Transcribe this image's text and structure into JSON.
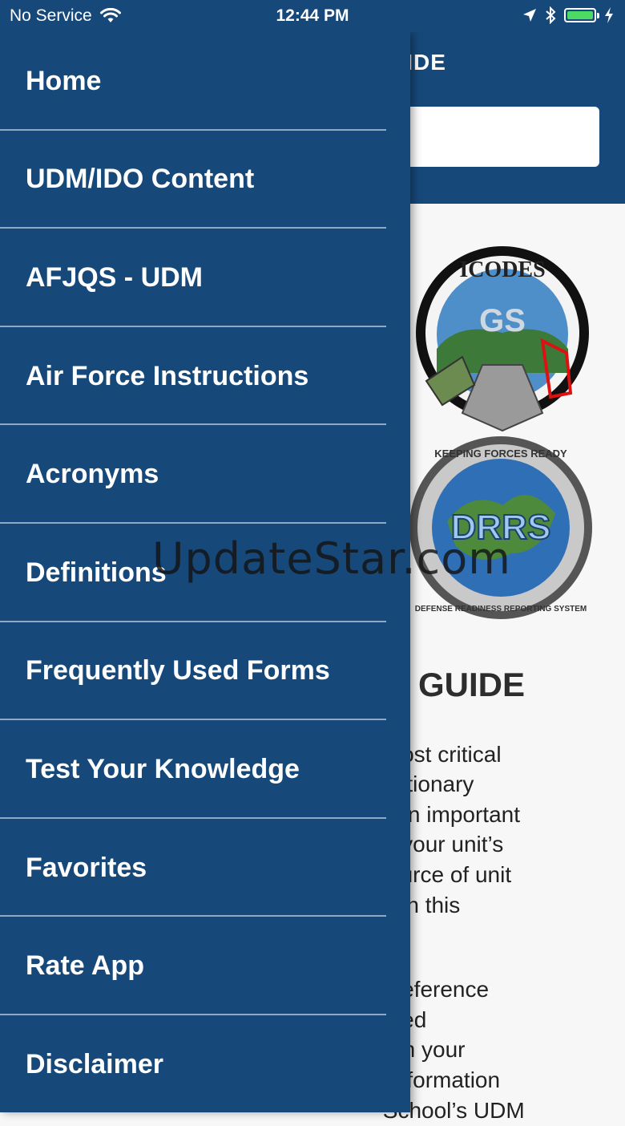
{
  "status_bar": {
    "carrier": "No Service",
    "time": "12:44 PM",
    "battery_level": 1.0,
    "icons": [
      "wifi-icon",
      "location-arrow-icon",
      "bluetooth-icon",
      "battery-icon",
      "charging-bolt-icon"
    ]
  },
  "background": {
    "header_title": "UIDE",
    "logo_top_text": "ICODES",
    "logo_top_center": "GS",
    "logo_bottom_top_text": "KEEPING FORCES READY",
    "logo_bottom_center": "DRRS",
    "logo_bottom_ring_text": "DEFENSE READINESS REPORTING SYSTEM",
    "heading": "GUIDE",
    "paragraph1": [
      " most critical",
      "editionary",
      "e an important",
      "of your unit’s",
      "source of unit",
      "n, in this"
    ],
    "paragraph2": [
      "k reference",
      "uired",
      "orm your",
      "f information",
      " School’s UDM"
    ]
  },
  "drawer": {
    "items": [
      {
        "label": "Home"
      },
      {
        "label": "UDM/IDO Content"
      },
      {
        "label": "AFJQS - UDM"
      },
      {
        "label": "Air Force Instructions"
      },
      {
        "label": "Acronyms"
      },
      {
        "label": "Definitions"
      },
      {
        "label": "Frequently Used Forms"
      },
      {
        "label": "Test Your Knowledge"
      },
      {
        "label": "Favorites"
      },
      {
        "label": "Rate App"
      },
      {
        "label": "Disclaimer"
      }
    ]
  },
  "watermark": "UpdateStar.com",
  "colors": {
    "primary": "#16497a",
    "divider": "#8fa9c4",
    "battery": "#4cd964",
    "background": "#f7f7f7"
  }
}
